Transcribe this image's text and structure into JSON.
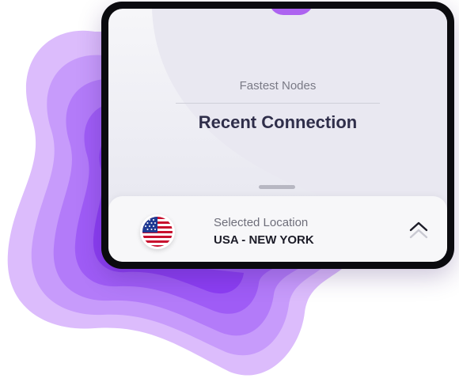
{
  "screen": {
    "section_label": "Fastest Nodes",
    "title": "Recent Connection"
  },
  "location_panel": {
    "label": "Selected Location",
    "value": "USA - NEW YORK",
    "flag_icon": "us-flag-icon",
    "expand_icon": "chevron-up-icon"
  },
  "colors": {
    "accent": "#a24bf0",
    "blob_outer": "#d8b4fb",
    "blob_inner": "#8c2cf3",
    "title": "#2f2e4a"
  }
}
